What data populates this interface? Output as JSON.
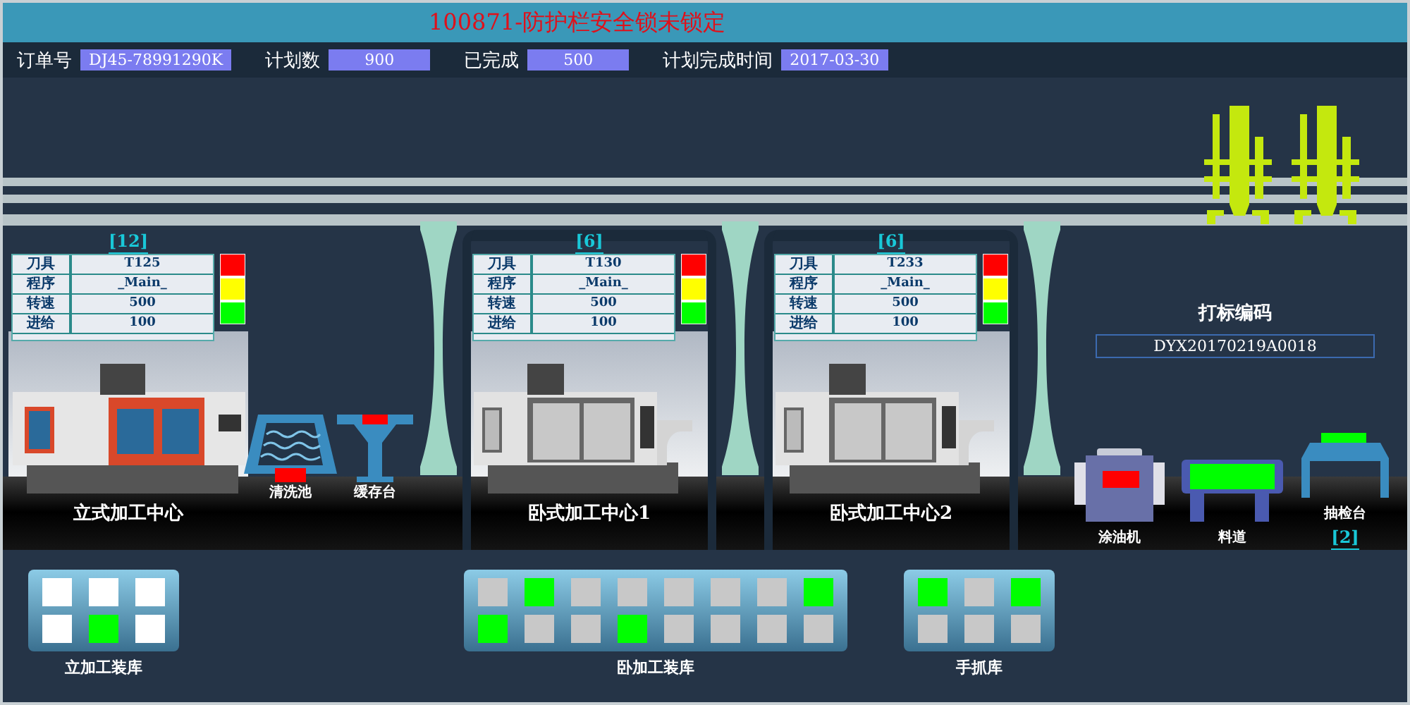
{
  "title": "100871-防护栏安全锁未锁定",
  "order": [
    {
      "label": "订单号",
      "value": "DJ45-78991290K"
    },
    {
      "label": "计划数",
      "value": "900"
    },
    {
      "label": "已完成",
      "value": "500"
    },
    {
      "label": "计划完成时间",
      "value": "2017-03-30"
    }
  ],
  "machines": [
    {
      "kind": "vertical",
      "count": "[12]",
      "name": "立式加工中心",
      "params": [
        {
          "label": "刀具",
          "value": "T125"
        },
        {
          "label": "程序",
          "value": "_Main_"
        },
        {
          "label": "转速",
          "value": "500"
        },
        {
          "label": "进给",
          "value": "100"
        }
      ]
    },
    {
      "kind": "horizontal",
      "count": "[6]",
      "name": "卧式加工中心1",
      "params": [
        {
          "label": "刀具",
          "value": "T130"
        },
        {
          "label": "程序",
          "value": "_Main_"
        },
        {
          "label": "转速",
          "value": "500"
        },
        {
          "label": "进给",
          "value": "100"
        }
      ]
    },
    {
      "kind": "horizontal",
      "count": "[6]",
      "name": "卧式加工中心2",
      "params": [
        {
          "label": "刀具",
          "value": "T233"
        },
        {
          "label": "程序",
          "value": "_Main_"
        },
        {
          "label": "转速",
          "value": "500"
        },
        {
          "label": "进给",
          "value": "100"
        }
      ]
    }
  ],
  "side_stations": [
    {
      "kind": "washer",
      "name": "清洗池",
      "color": "#ff0000"
    },
    {
      "kind": "buffer",
      "name": "缓存台",
      "color": "#ff0000"
    }
  ],
  "marking": {
    "label": "打标编码",
    "value": "DYX20170219A0018"
  },
  "end_stations": [
    {
      "kind": "oiler",
      "name": "涂油机",
      "color": "#ff0000"
    },
    {
      "kind": "chute",
      "name": "料道",
      "color": "#00ff00"
    },
    {
      "kind": "inspection",
      "name": "抽检台",
      "color": "#00ff00",
      "count": "[2]"
    }
  ],
  "libraries": [
    {
      "name": "立加工装库",
      "color": "#ffffff",
      "rows": [
        [
          false,
          false,
          false
        ],
        [
          false,
          true,
          false
        ]
      ]
    },
    {
      "name": "卧加工装库",
      "color": "#c8c8c8",
      "rows": [
        [
          false,
          true,
          false,
          false,
          false,
          false,
          false,
          true
        ],
        [
          true,
          false,
          false,
          true,
          false,
          false,
          false,
          false
        ]
      ]
    },
    {
      "name": "手抓库",
      "color": "#c8c8c8",
      "rows": [
        [
          true,
          false,
          true
        ],
        [
          false,
          false,
          false
        ]
      ]
    }
  ]
}
